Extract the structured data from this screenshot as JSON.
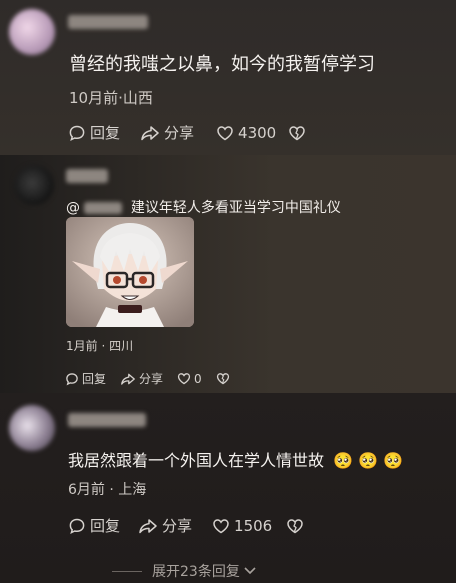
{
  "comments": [
    {
      "text": "曾经的我嗤之以鼻，如今的我暂停学习",
      "meta": "10月前·山西",
      "reply_label": "回复",
      "share_label": "分享",
      "likes": "4300"
    },
    {
      "mention": "@",
      "text": "建议年轻人多看亚当学习中国礼仪",
      "meta": "1月前 · 四川",
      "reply_label": "回复",
      "share_label": "分享",
      "likes": "0"
    },
    {
      "text": "我居然跟着一个外国人在学人情世故",
      "emoji": "🥺 🥺 🥺",
      "meta": "6月前 · 上海",
      "reply_label": "回复",
      "share_label": "分享",
      "likes": "1506",
      "expand_label": "展开23条回复"
    }
  ],
  "colors": {
    "text": "#f2f2f2",
    "meta": "#cfcac5",
    "expand": "#a8a29d"
  },
  "icons": [
    "reply-icon",
    "share-icon",
    "heart-icon",
    "dislike-heart-icon",
    "chevron-down-icon"
  ]
}
